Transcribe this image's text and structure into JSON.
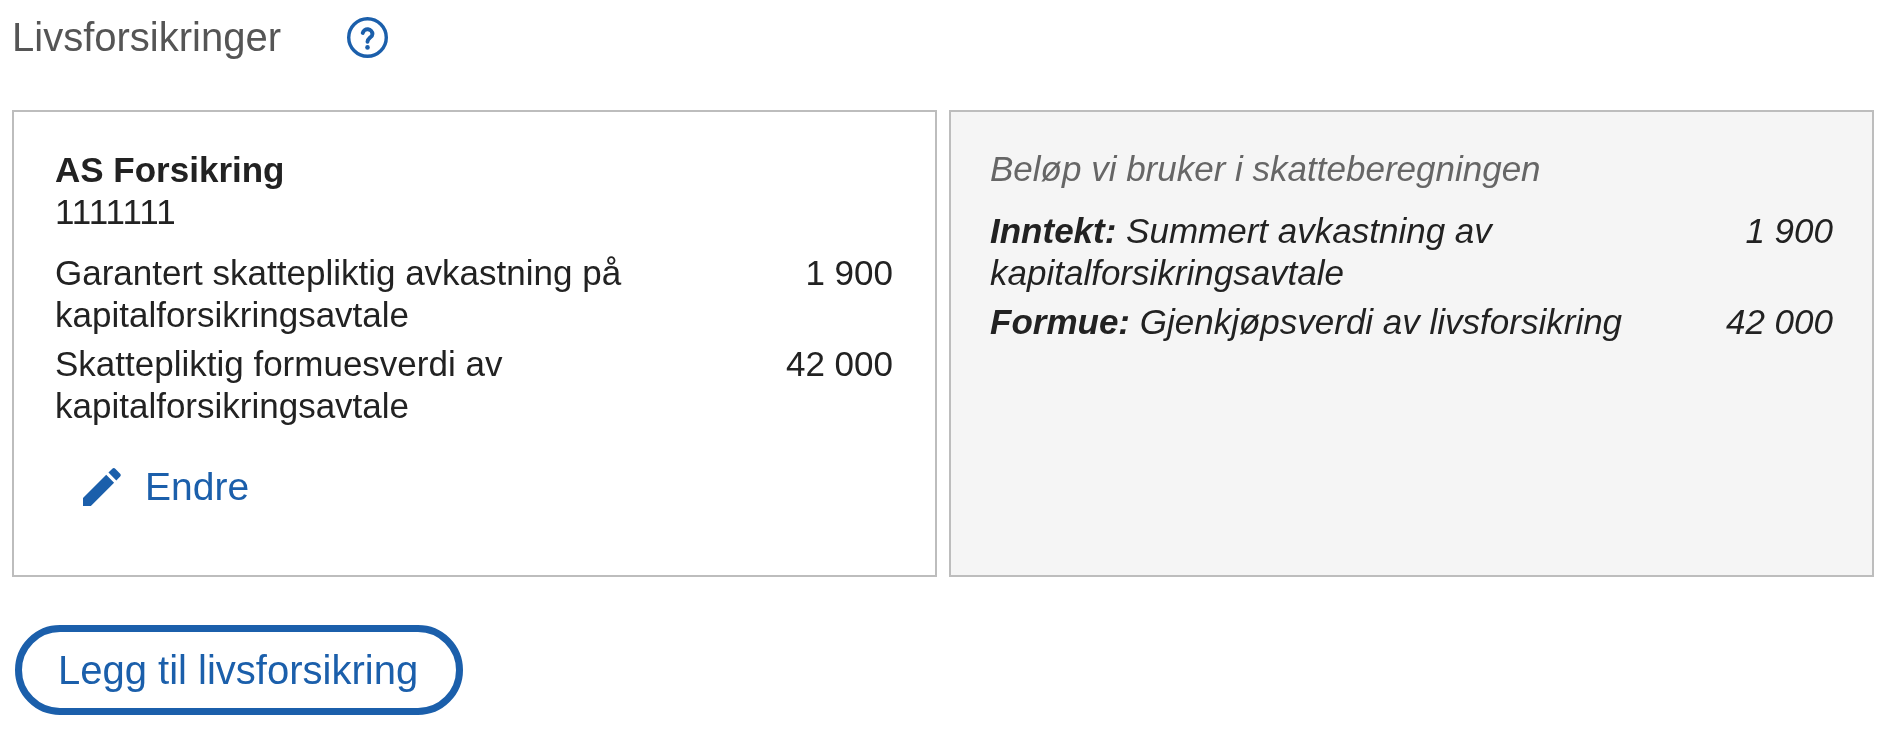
{
  "header": {
    "title": "Livsforsikringer"
  },
  "insurance_card": {
    "company": "AS Forsikring",
    "number": "1111111",
    "rows": [
      {
        "label": "Garantert skattepliktig avkastning på kapitalforsikringsavtale",
        "value": "1 900"
      },
      {
        "label": "Skattepliktig formuesverdi av kapitalforsikringsavtale",
        "value": "42 000"
      }
    ],
    "edit_link": "Endre"
  },
  "tax_card": {
    "heading": "Beløp vi bruker i skatteberegningen",
    "rows": [
      {
        "label": "**Inntekt:** Summert avkastning av kapitalforsikringsavtale",
        "value": "1 900"
      },
      {
        "label": "**Formue:** Gjenkjøpsverdi av livsforsikring",
        "value": "42 000"
      }
    ]
  },
  "add_button": "Legg til livsforsikring"
}
